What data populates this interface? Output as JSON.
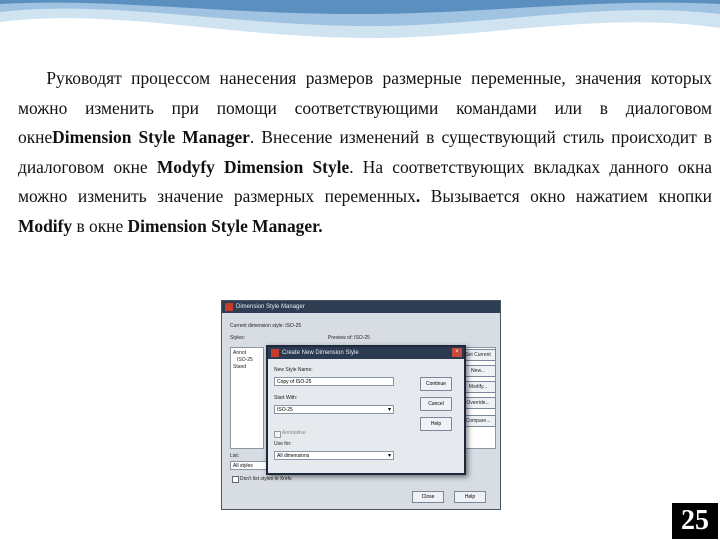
{
  "paragraph": {
    "t1": "Руководят процессом нанесения размеров размерные переменные, значения которых можно изменить при помощи соответствующими командами или в диалоговом окне",
    "b1": "Dimension Style Manager",
    "t2": ". Внесение изменений в существующий стиль происходит в диалоговом окне ",
    "b2": "Modyfy Dimension Style",
    "t3": ". На соответствующих вкладках данного окна можно изменить значение размерных переменных",
    "b3": ".",
    "t4": " Вызывается окно нажатием кнопки ",
    "b4": "Modify",
    "t5": " в окне ",
    "b5": "Dimension Style Manager",
    "b6": "."
  },
  "screenshot": {
    "window_title": "Dimension Style Manager",
    "current_style": "Current dimension style: ISO-25",
    "styles_label": "Styles:",
    "preview_label": "Preview of: ISO-25",
    "style_items": [
      "Annot",
      "ISO-25",
      "Stand"
    ],
    "list_label": "List:",
    "list_value": "All styles",
    "dont_list": "Don't list styles in Xrefs",
    "right_buttons": [
      "Set Current",
      "New...",
      "Modify...",
      "Override...",
      "Compare..."
    ],
    "bottom_buttons": [
      "Close",
      "Help"
    ],
    "dialog": {
      "title": "Create New Dimension Style",
      "new_style_label": "New Style Name:",
      "new_style_value": "Copy of ISO-25",
      "start_with_label": "Start With:",
      "start_with_value": "ISO-25",
      "annotative_label": "Annotative",
      "use_for_label": "Use for:",
      "use_for_value": "All dimensions",
      "continue_btn": "Continue",
      "cancel_btn": "Cancel",
      "help_btn": "Help"
    }
  },
  "page_number": "25",
  "colors": {
    "wave_light": "#cfe3f1",
    "wave_dark": "#5b8fbf",
    "text": "#111111"
  }
}
